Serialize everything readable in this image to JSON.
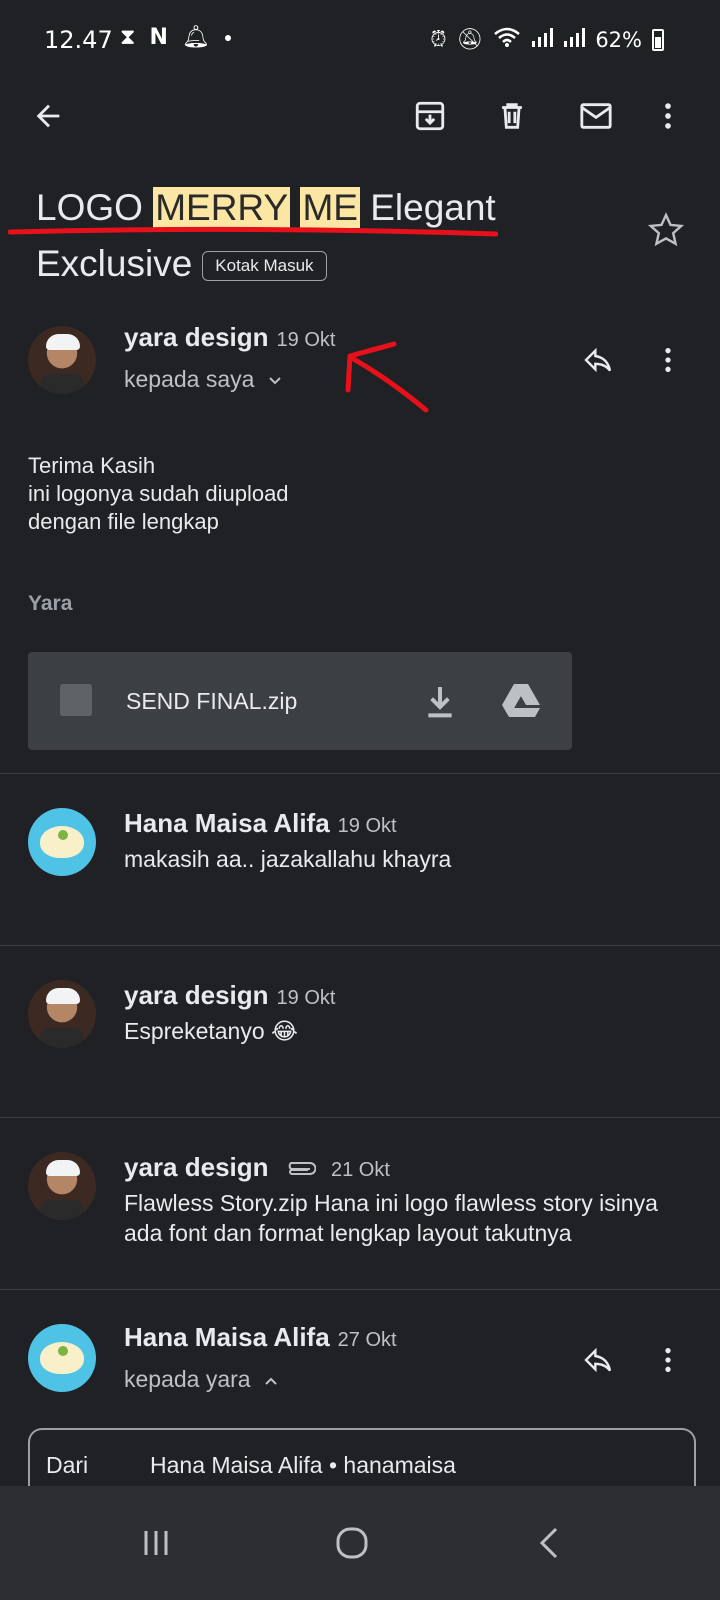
{
  "status_bar": {
    "time": "12.47",
    "battery": "62%"
  },
  "email": {
    "subject_parts": [
      "LOGO ",
      "MERRY",
      " ",
      "ME",
      " Elegant"
    ],
    "subject_line2": "Exclusive",
    "label_badge": "Kotak Masuk"
  },
  "messages": [
    {
      "sender": "yara design",
      "date": "19 Okt",
      "recipient": "kepada saya",
      "body": [
        "Terima Kasih",
        "ini logonya sudah diupload",
        "dengan file lengkap"
      ],
      "signature": "Yara",
      "attachment": "SEND FINAL.zip"
    },
    {
      "sender": "Hana Maisa Alifa",
      "date": "19 Okt",
      "snippet": "makasih aa.. jazakallahu khayra"
    },
    {
      "sender": "yara design",
      "date": "19 Okt",
      "snippet": "Espreketanyo 😂"
    },
    {
      "sender": "yara design",
      "date": "21 Okt",
      "snippet": "Flawless Story.zip Hana ini logo flawless story isinya ada font dan format lengkap layout takutnya"
    },
    {
      "sender": "Hana Maisa Alifa",
      "date": "27 Okt",
      "recipient": "kepada yara",
      "from_label": "Dari",
      "from_value": "Hana Maisa Alifa • hanamaisa"
    }
  ]
}
